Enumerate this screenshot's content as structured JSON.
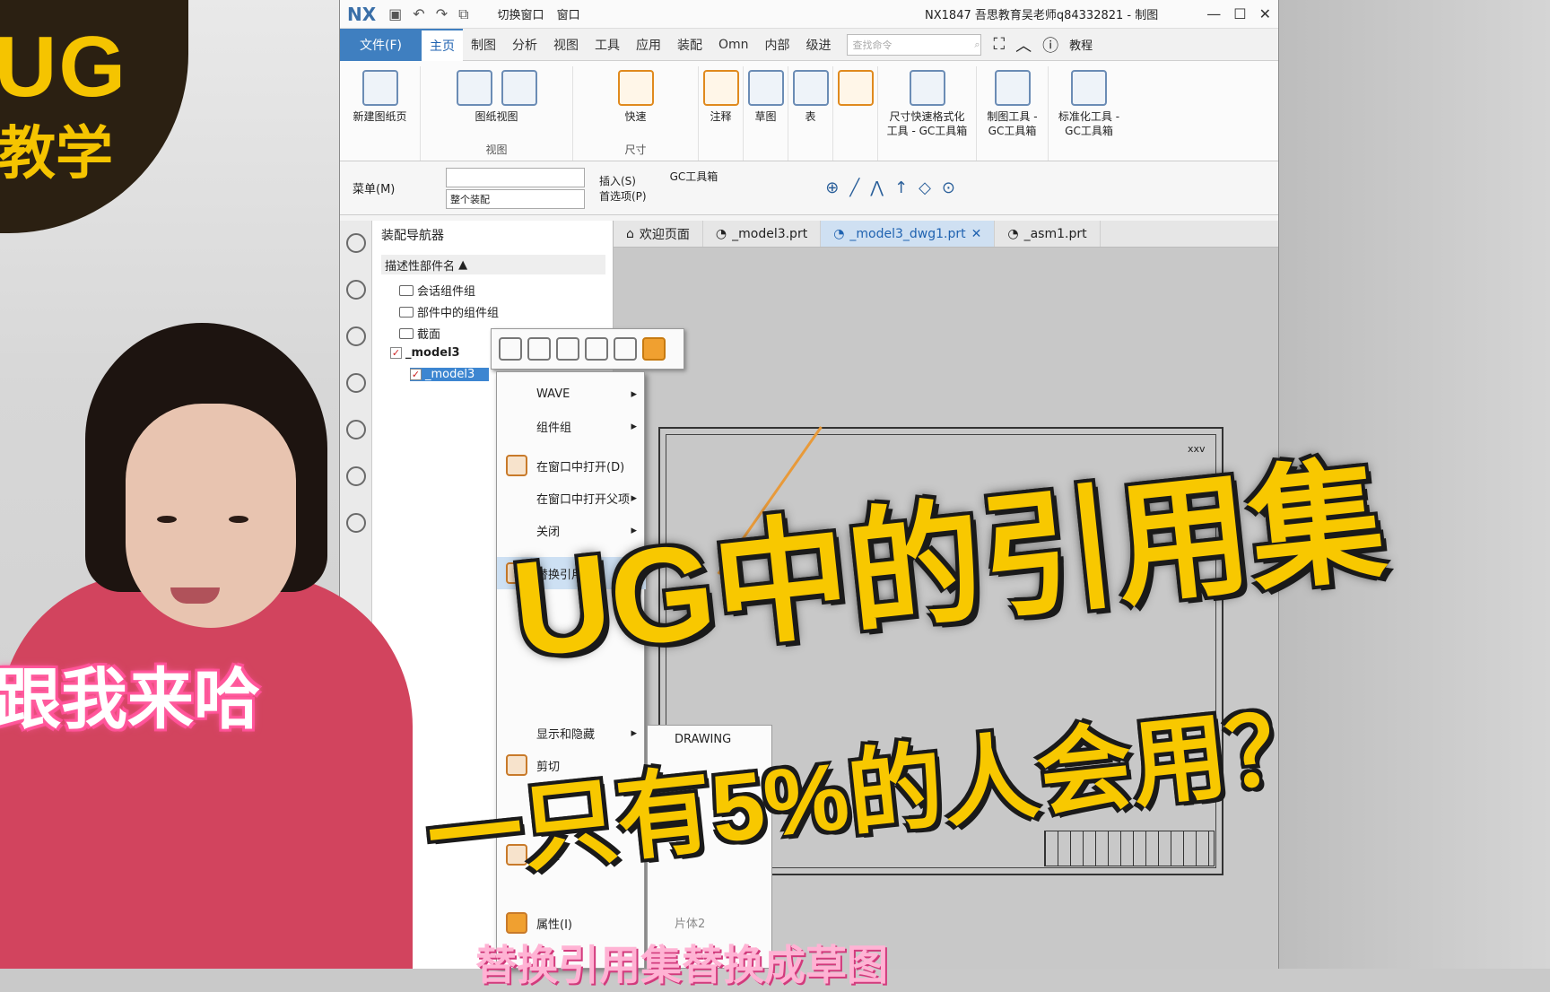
{
  "window": {
    "logo": "NX",
    "title": "NX1847 吾思教育吴老师q84332821 - 制图",
    "switch_window": "切换窗口",
    "window_menu": "窗口"
  },
  "tabs": [
    "文件(F)",
    "主页",
    "制图",
    "分析",
    "视图",
    "工具",
    "应用",
    "装配",
    "Omn",
    "内部",
    "级进"
  ],
  "search_placeholder": "查找命令",
  "tutorial_label": "教程",
  "ribbon": {
    "new_sheet": "新建图纸页",
    "base_view": "图纸视图",
    "views_group": "视图",
    "quick": "快速",
    "dim_group": "尺寸",
    "note": "注释",
    "sketch": "草图",
    "table": "表",
    "dim_format": "尺寸快速格式化工具 - GC工具箱",
    "drafting_tools": "制图工具 - GC工具箱",
    "std_tools": "标准化工具 - GC工具箱"
  },
  "toolbar2": {
    "menu": "菜单(M)",
    "assembly_scope": "整个装配",
    "insert": "插入(S)",
    "prefs": "首选项(P)",
    "gc_tools": "GC工具箱"
  },
  "doc_tabs": [
    "欢迎页面",
    "_model3.prt",
    "_model3_dwg1.prt",
    "_asm1.prt"
  ],
  "navigator": {
    "title": "装配导航器",
    "column": "描述性部件名",
    "items": [
      "会话组件组",
      "部件中的组件组",
      "截面",
      "_model3",
      "_model3"
    ]
  },
  "context_menu": [
    "WAVE",
    "组件组",
    "在窗口中打开(D)",
    "在窗口中打开父项",
    "关闭",
    "替换引用集",
    "显示和隐藏",
    "剪切",
    "删除",
    "属性(I)"
  ],
  "submenu": [
    "DRAWING",
    "片体2"
  ],
  "drawing_mark": "xxv",
  "overlay": {
    "logo_top": "UG",
    "logo_bottom": "教学",
    "sticker": "跟我来哈",
    "headline1": "UG中的引用集",
    "headline2": "一只有5%的人会用？",
    "caption": "替换引用集替换成草图"
  }
}
